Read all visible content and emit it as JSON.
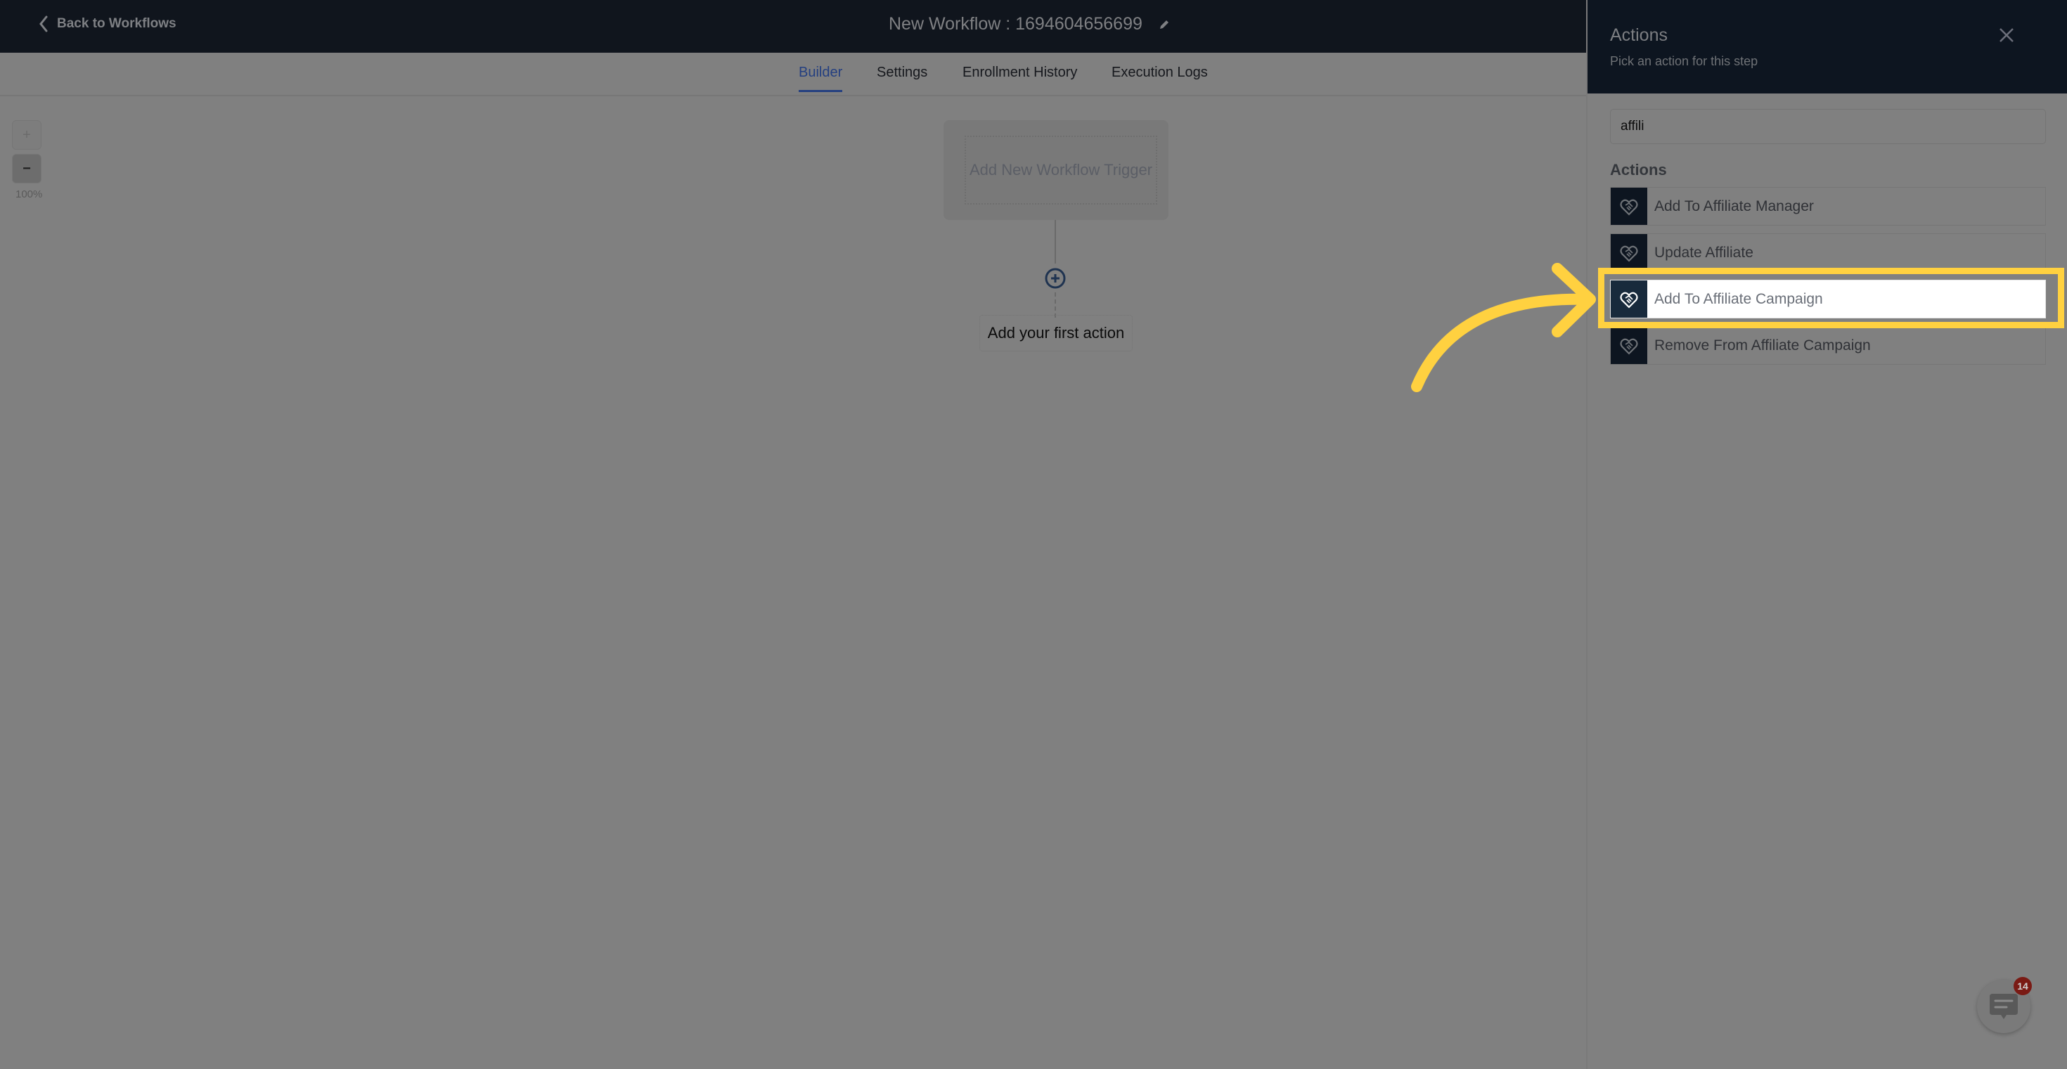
{
  "header": {
    "back_label": "Back to Workflows",
    "workflow_title": "New Workflow : 1694604656699"
  },
  "tabs": [
    {
      "label": "Builder",
      "active": true
    },
    {
      "label": "Settings",
      "active": false
    },
    {
      "label": "Enrollment History",
      "active": false
    },
    {
      "label": "Execution Logs",
      "active": false
    }
  ],
  "canvas": {
    "zoom_in_label": "+",
    "zoom_out_label": "−",
    "zoom_level": "100%",
    "trigger_label": "Add New Workflow Trigger",
    "first_action_label": "Add your first action"
  },
  "panel": {
    "title": "Actions",
    "subtitle": "Pick an action for this step",
    "search_value": "affili",
    "section_label": "Actions",
    "actions": [
      {
        "label": "Add To Affiliate Manager",
        "icon": "handshake-icon",
        "highlighted": false
      },
      {
        "label": "Update Affiliate",
        "icon": "handshake-icon",
        "highlighted": false
      },
      {
        "label": "Add To Affiliate Campaign",
        "icon": "handshake-icon",
        "highlighted": true
      },
      {
        "label": "Remove From Affiliate Campaign",
        "icon": "handshake-icon",
        "highlighted": false
      }
    ]
  },
  "chat_widget": {
    "badge_count": "14"
  },
  "annotation": {
    "highlight_color": "#ffd140",
    "accent_color": "#243f80"
  }
}
